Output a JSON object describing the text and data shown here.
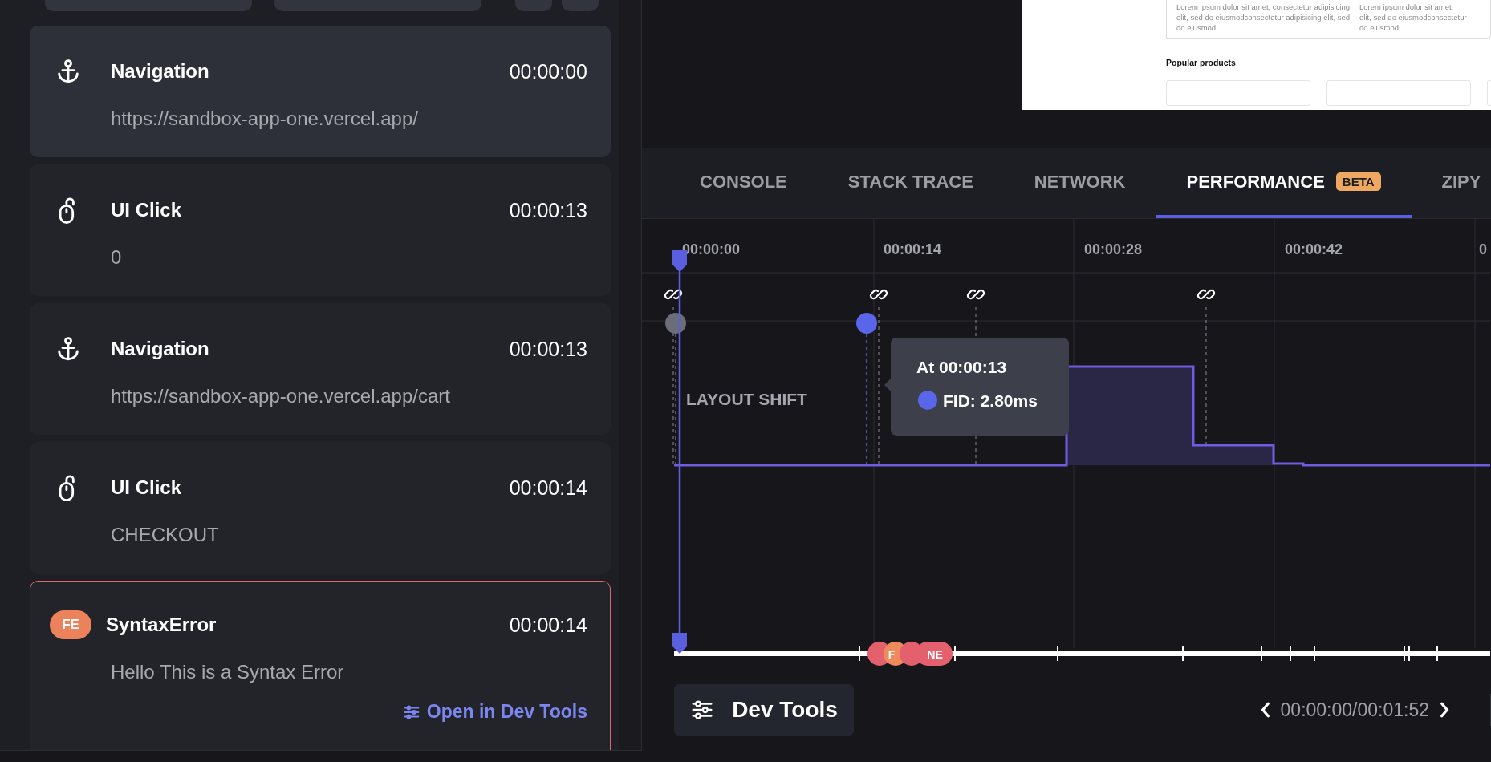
{
  "toolbar": {
    "buttons": [
      {
        "kind": "wide"
      },
      {
        "kind": "wide"
      },
      {
        "kind": "small"
      },
      {
        "kind": "small"
      }
    ]
  },
  "events": [
    {
      "kind": "navigation",
      "title": "Navigation",
      "time": "00:00:00",
      "detail": "https://sandbox-app-one.vercel.app/",
      "selected": true
    },
    {
      "kind": "click",
      "title": "UI Click",
      "time": "00:00:13",
      "detail": "0",
      "selected": false
    },
    {
      "kind": "navigation",
      "title": "Navigation",
      "time": "00:00:13",
      "detail": "https://sandbox-app-one.vercel.app/cart",
      "selected": false
    },
    {
      "kind": "click",
      "title": "UI Click",
      "time": "00:00:14",
      "detail": "CHECKOUT",
      "selected": false
    },
    {
      "kind": "error",
      "badge": "FE",
      "title": "SyntaxError",
      "time": "00:00:14",
      "detail": "Hello This is a Syntax Error",
      "link": "Open in Dev Tools",
      "selected": false
    }
  ],
  "preview": {
    "columns": [
      [
        "Lorem ipsum dolor sit amet, consectetur adipisicing",
        "elit, sed do eiusmodconsectetur adipisicing elit, sed",
        "do eiusmod"
      ],
      [
        "Lorem ipsum dolor sit amet,",
        "elit, sed do eiusmodconsectetur",
        "do eiusmod"
      ]
    ],
    "heading": "Popular products"
  },
  "tabs": [
    {
      "label": "CONSOLE",
      "selected": false
    },
    {
      "label": "STACK TRACE",
      "selected": false
    },
    {
      "label": "NETWORK",
      "selected": false
    },
    {
      "label": "PERFORMANCE",
      "badge": "BETA",
      "selected": true
    },
    {
      "label": "ZIPY",
      "selected": false
    }
  ],
  "timeline": {
    "ticks": [
      "00:00:00",
      "00:00:14",
      "00:00:28",
      "00:00:42",
      "0"
    ],
    "metric_label": "LAYOUT SHIFT",
    "tooltip": {
      "time": "At 00:00:13",
      "value": "FID: 2.80ms",
      "color": "#5a66ea"
    },
    "markers": [
      {
        "color": "#6b6e78"
      },
      {
        "color": "#5a66ea"
      }
    ],
    "badges": [
      {
        "color": "#e4606d"
      },
      {
        "label": "F",
        "color": "#ee8a5c"
      },
      {
        "color": "#e4606d"
      },
      {
        "label": "NE",
        "color": "#e4606d"
      }
    ]
  },
  "footer": {
    "button": "Dev Tools",
    "position": "00:00:00/00:01:52"
  }
}
